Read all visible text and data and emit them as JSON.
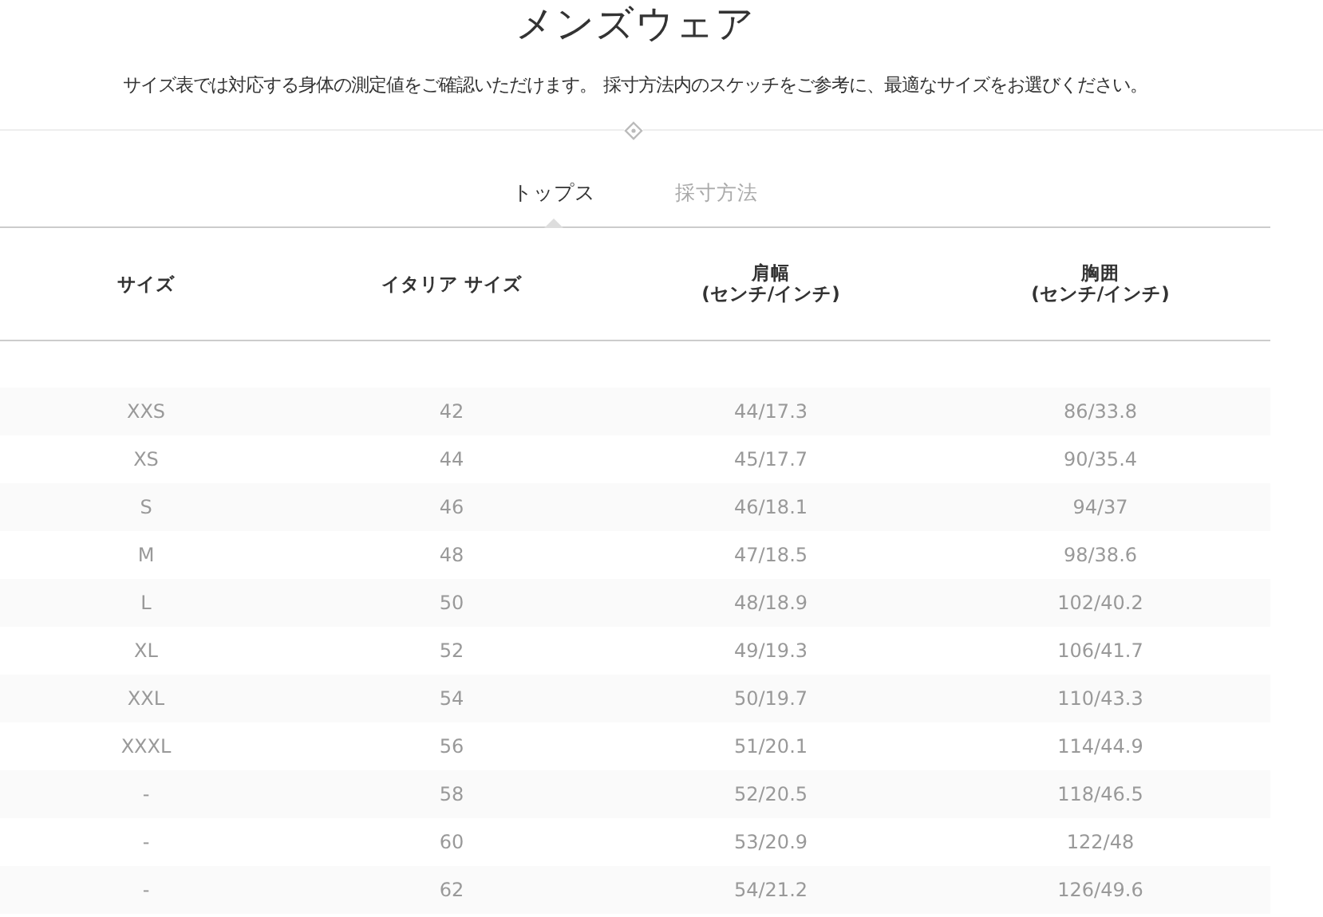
{
  "title": "メンズウェア",
  "description": "サイズ表では対応する身体の測定値をご確認いただけます。 採寸方法内のスケッチをご参考に、最適なサイズをお選びください。",
  "tabs": [
    {
      "label": "トップス",
      "selected": true
    },
    {
      "label": "採寸方法",
      "selected": false
    }
  ],
  "table": {
    "columns": [
      "サイズ",
      "イタリア サイズ",
      "肩幅\n(センチ/インチ)",
      "胸囲\n(センチ/インチ)"
    ],
    "rows": [
      [
        "XXS",
        "42",
        "44/17.3",
        "86/33.8"
      ],
      [
        "XS",
        "44",
        "45/17.7",
        "90/35.4"
      ],
      [
        "S",
        "46",
        "46/18.1",
        "94/37"
      ],
      [
        "M",
        "48",
        "47/18.5",
        "98/38.6"
      ],
      [
        "L",
        "50",
        "48/18.9",
        "102/40.2"
      ],
      [
        "XL",
        "52",
        "49/19.3",
        "106/41.7"
      ],
      [
        "XXL",
        "54",
        "50/19.7",
        "110/43.3"
      ],
      [
        "XXXL",
        "56",
        "51/20.1",
        "114/44.9"
      ],
      [
        "-",
        "58",
        "52/20.5",
        "118/46.5"
      ],
      [
        "-",
        "60",
        "53/20.9",
        "122/48"
      ],
      [
        "-",
        "62",
        "54/21.2",
        "126/49.6"
      ]
    ]
  }
}
